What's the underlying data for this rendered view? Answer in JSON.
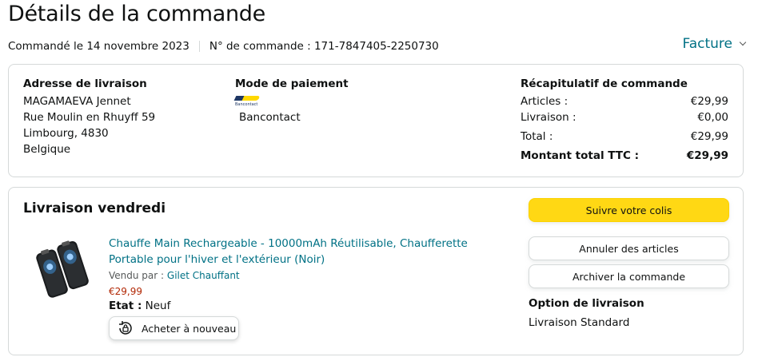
{
  "header": {
    "title": "Détails de la commande",
    "order_date": "Commandé le 14 novembre 2023",
    "order_number": "N° de commande : 171-7847405-2250730",
    "invoice_label": "Facture"
  },
  "shipping_address": {
    "heading": "Adresse de livraison",
    "lines": [
      "MAGAMAEVA Jennet",
      "Rue Moulin en Rhuyff 59",
      "Limbourg, 4830",
      "Belgique"
    ]
  },
  "payment": {
    "heading": "Mode de paiement",
    "logo_text": "Bancontact",
    "method": "Bancontact"
  },
  "summary": {
    "heading": "Récapitulatif de commande",
    "rows": [
      {
        "label": "Articles :",
        "value": "€29,99"
      },
      {
        "label": "Livraison :",
        "value": "€0,00"
      },
      {
        "label": "Total :",
        "value": "€29,99"
      },
      {
        "label": "Montant total TTC :",
        "value": "€29,99"
      }
    ]
  },
  "delivery": {
    "title": "Livraison vendredi",
    "product": {
      "title": "Chauffe Main Rechargeable - 10000mAh Réutilisable, Chaufferette Portable pour l'hiver et l'extérieur (Noir)",
      "seller_prefix": "Vendu par : ",
      "seller_name": "Gilet Chauffant",
      "price": "€29,99",
      "condition_label": "Etat :",
      "condition_value": " Neuf"
    },
    "rebuy_label": "Acheter à nouveau",
    "actions": {
      "track": "Suivre votre colis",
      "cancel": "Annuler des articles",
      "archive": "Archiver la commande"
    },
    "shipping_option": {
      "heading": "Option de livraison",
      "value": "Livraison Standard"
    }
  },
  "colors": {
    "link": "#007185",
    "price": "#b12704",
    "primary_button": "#ffd814",
    "border": "#d5d9d9",
    "bancontact_blue": "#1e3764",
    "bancontact_yellow": "#ffd800"
  }
}
